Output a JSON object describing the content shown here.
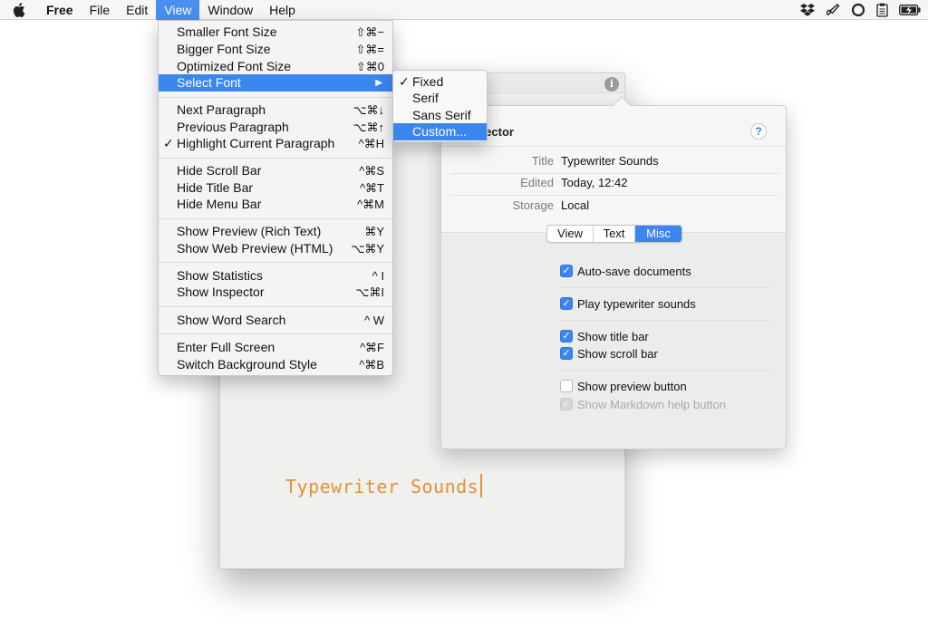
{
  "menubar": {
    "app_name": "Free",
    "menus": [
      "File",
      "Edit",
      "View",
      "Window",
      "Help"
    ],
    "active_menu": "View",
    "status_icons": [
      "dropbox-icon",
      "brush-icon",
      "sync-icon",
      "clipboard-icon",
      "battery-icon"
    ]
  },
  "view_menu": {
    "items": [
      {
        "label": "Smaller Font Size",
        "shortcut": "⇧⌘−"
      },
      {
        "label": "Bigger Font Size",
        "shortcut": "⇧⌘="
      },
      {
        "label": "Optimized Font Size",
        "shortcut": "⇧⌘0"
      },
      {
        "label": "Select Font",
        "shortcut": "▶"
      },
      {
        "label": "Next Paragraph",
        "shortcut": "⌥⌘↓"
      },
      {
        "label": "Previous Paragraph",
        "shortcut": "⌥⌘↑"
      },
      {
        "label": "Highlight Current Paragraph",
        "shortcut": "^⌘H",
        "check": "✓"
      },
      {
        "label": "Hide Scroll Bar",
        "shortcut": "^⌘S"
      },
      {
        "label": "Hide Title Bar",
        "shortcut": "^⌘T"
      },
      {
        "label": "Hide Menu Bar",
        "shortcut": "^⌘M"
      },
      {
        "label": "Show Preview (Rich Text)",
        "shortcut": "⌘Y"
      },
      {
        "label": "Show Web Preview (HTML)",
        "shortcut": "⌥⌘Y"
      },
      {
        "label": "Show Statistics",
        "shortcut": "^ I"
      },
      {
        "label": "Show Inspector",
        "shortcut": "⌥⌘I"
      },
      {
        "label": "Show Word Search",
        "shortcut": "^ W"
      },
      {
        "label": "Enter Full Screen",
        "shortcut": "^⌘F"
      },
      {
        "label": "Switch Background Style",
        "shortcut": "^⌘B"
      }
    ],
    "highlighted": "Select Font"
  },
  "font_submenu": {
    "items": [
      {
        "label": "Fixed",
        "check": "✓"
      },
      {
        "label": "Serif",
        "check": ""
      },
      {
        "label": "Sans Serif",
        "check": ""
      },
      {
        "label": "Custom...",
        "check": ""
      }
    ],
    "highlighted": "Custom..."
  },
  "editor": {
    "text": "Typewriter Sounds",
    "text_color": "#e59135",
    "info_glyph": "i"
  },
  "inspector": {
    "title_visible": "ector",
    "help_glyph": "?",
    "meta": [
      {
        "label": "Title",
        "value": "Typewriter Sounds"
      },
      {
        "label": "Edited",
        "value": "Today, 12:42"
      },
      {
        "label": "Storage",
        "value": "Local"
      }
    ],
    "tabs": [
      "View",
      "Text",
      "Misc"
    ],
    "selected_tab": "Misc",
    "options": [
      {
        "label": "Auto-save documents",
        "state": "checked"
      },
      {
        "label": "Play typewriter sounds",
        "state": "checked"
      },
      {
        "label": "Show title bar",
        "state": "checked"
      },
      {
        "label": "Show scroll bar",
        "state": "checked"
      },
      {
        "label": "Show preview button",
        "state": "unchecked"
      },
      {
        "label": "Show Markdown help button",
        "state": "disabled"
      }
    ],
    "accent_color": "#3a86f2"
  }
}
